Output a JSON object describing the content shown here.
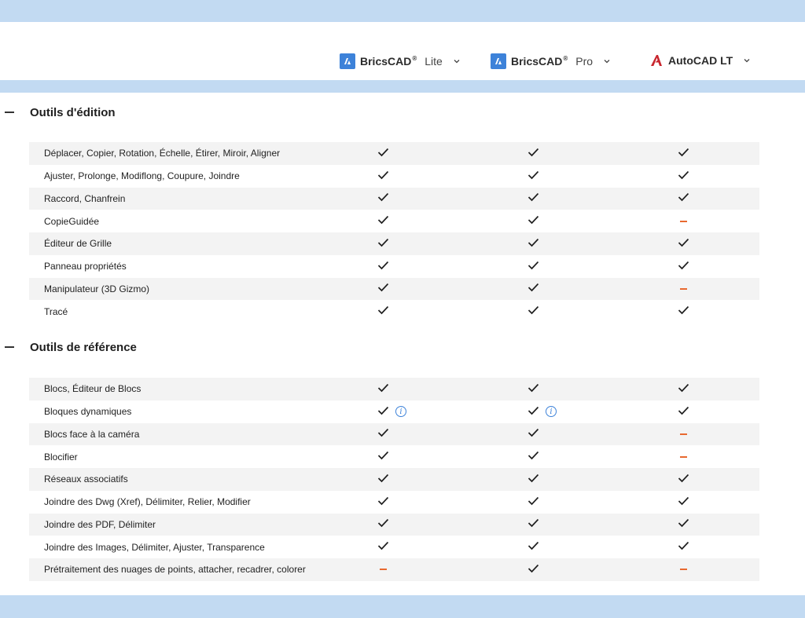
{
  "colors": {
    "band": "#c2daf2",
    "accent": "#3d82d9",
    "dash": "#e8692f",
    "autocad_red": "#c8262e"
  },
  "header": {
    "products": [
      {
        "brand": "BricsCAD",
        "mark": "®",
        "tier": "Lite",
        "icon": "bricscad-logo-icon"
      },
      {
        "brand": "BricsCAD",
        "mark": "®",
        "tier": "Pro",
        "icon": "bricscad-logo-icon"
      },
      {
        "brand": "AutoCAD LT",
        "mark": "",
        "tier": "",
        "icon": "autocad-logo-icon"
      }
    ]
  },
  "sections": [
    {
      "title": "Outils d'édition",
      "rows": [
        {
          "label": "Déplacer, Copier, Rotation, Échelle, Étirer, Miroir, Aligner",
          "lite": "check",
          "pro": "check",
          "lt": "check"
        },
        {
          "label": "Ajuster, Prolonge, Modiflong, Coupure, Joindre",
          "lite": "check",
          "pro": "check",
          "lt": "check"
        },
        {
          "label": "Raccord, Chanfrein",
          "lite": "check",
          "pro": "check",
          "lt": "check"
        },
        {
          "label": "CopieGuidée",
          "lite": "check",
          "pro": "check",
          "lt": "dash"
        },
        {
          "label": "Éditeur de Grille",
          "lite": "check",
          "pro": "check",
          "lt": "check"
        },
        {
          "label": "Panneau propriétés",
          "lite": "check",
          "pro": "check",
          "lt": "check"
        },
        {
          "label": "Manipulateur (3D Gizmo)",
          "lite": "check",
          "pro": "check",
          "lt": "dash"
        },
        {
          "label": "Tracé",
          "lite": "check",
          "pro": "check",
          "lt": "check"
        }
      ]
    },
    {
      "title": "Outils de référence",
      "rows": [
        {
          "label": "Blocs, Éditeur de Blocs",
          "lite": "check",
          "pro": "check",
          "lt": "check"
        },
        {
          "label": "Bloques dynamiques",
          "lite": "check-info",
          "pro": "check-info",
          "lt": "check"
        },
        {
          "label": "Blocs face à la caméra",
          "lite": "check",
          "pro": "check",
          "lt": "dash"
        },
        {
          "label": "Blocifier",
          "lite": "check",
          "pro": "check",
          "lt": "dash"
        },
        {
          "label": "Réseaux associatifs",
          "lite": "check",
          "pro": "check",
          "lt": "check"
        },
        {
          "label": "Joindre des Dwg (Xref), Délimiter, Relier, Modifier",
          "lite": "check",
          "pro": "check",
          "lt": "check"
        },
        {
          "label": "Joindre des PDF, Délimiter",
          "lite": "check",
          "pro": "check",
          "lt": "check"
        },
        {
          "label": "Joindre des Images, Délimiter, Ajuster, Transparence",
          "lite": "check",
          "pro": "check",
          "lt": "check"
        },
        {
          "label": "Prétraitement des nuages de points, attacher, recadrer, colorer",
          "lite": "dash",
          "pro": "check",
          "lt": "dash"
        }
      ]
    }
  ]
}
